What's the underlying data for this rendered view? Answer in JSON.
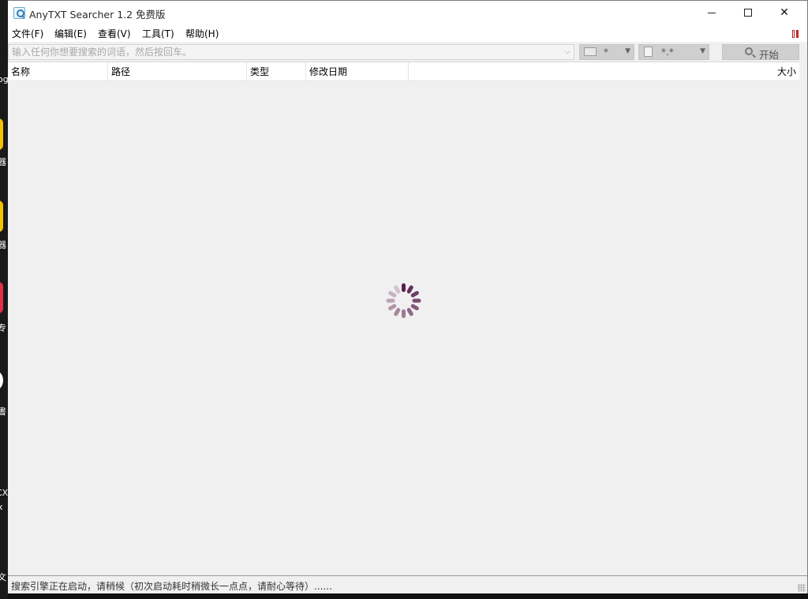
{
  "window": {
    "title": "AnyTXT Searcher 1.2 免费版"
  },
  "menu": {
    "items": [
      "文件(F)",
      "编辑(E)",
      "查看(V)",
      "工具(T)",
      "帮助(H)"
    ]
  },
  "toolbar": {
    "search_placeholder": "输入任何你想要搜索的词语，然后按回车。",
    "drive_value": "*",
    "ext_value": "*.*",
    "start_label": "开始"
  },
  "table": {
    "columns": [
      "名称",
      "路径",
      "类型",
      "修改日期",
      "大小"
    ],
    "rows": []
  },
  "status": {
    "text": "搜索引擎正在启动，请稍候（初次启动耗时稍微长一点点，请耐心等待）......"
  },
  "desktop_edge": {
    "labels": [
      "og",
      "器",
      "器",
      "专",
      "書",
      "CX",
      "x",
      "文"
    ]
  },
  "colors": {
    "spinner": "#5b1f4e",
    "accent_flag": "#c33333"
  }
}
